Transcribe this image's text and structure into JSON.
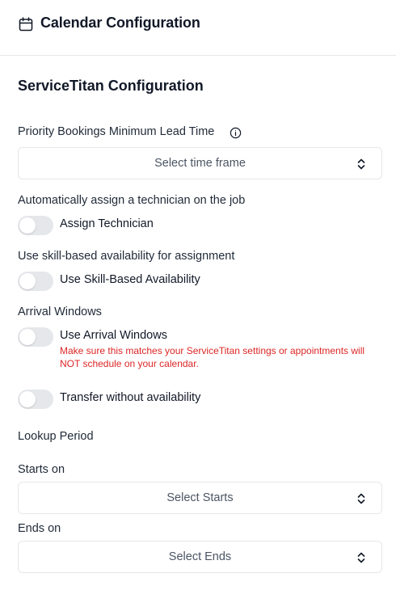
{
  "header": {
    "title": "Calendar Configuration",
    "icon": "calendar-icon"
  },
  "section": {
    "title": "ServiceTitan Configuration"
  },
  "priority": {
    "label": "Priority Bookings Minimum Lead Time",
    "select_value": "Select time frame"
  },
  "assign": {
    "label": "Automatically assign a technician on the job",
    "toggle_label": "Assign Technician",
    "enabled": false
  },
  "skill": {
    "label": "Use skill-based availability for assignment",
    "toggle_label": "Use Skill-Based Availability",
    "enabled": false
  },
  "arrival": {
    "label": "Arrival Windows",
    "toggle_label": "Use Arrival Windows",
    "warning": "Make sure this matches your ServiceTitan settings or appointments will NOT schedule on your calendar.",
    "enabled": false
  },
  "transfer": {
    "toggle_label": "Transfer without availability",
    "enabled": false
  },
  "lookup": {
    "title": "Lookup Period",
    "starts_label": "Starts on",
    "starts_value": "Select Starts",
    "ends_label": "Ends on",
    "ends_value": "Select Ends"
  },
  "colors": {
    "warning": "#dc2626",
    "toggle_off": "#e5e7eb",
    "border": "#e5e7eb"
  }
}
